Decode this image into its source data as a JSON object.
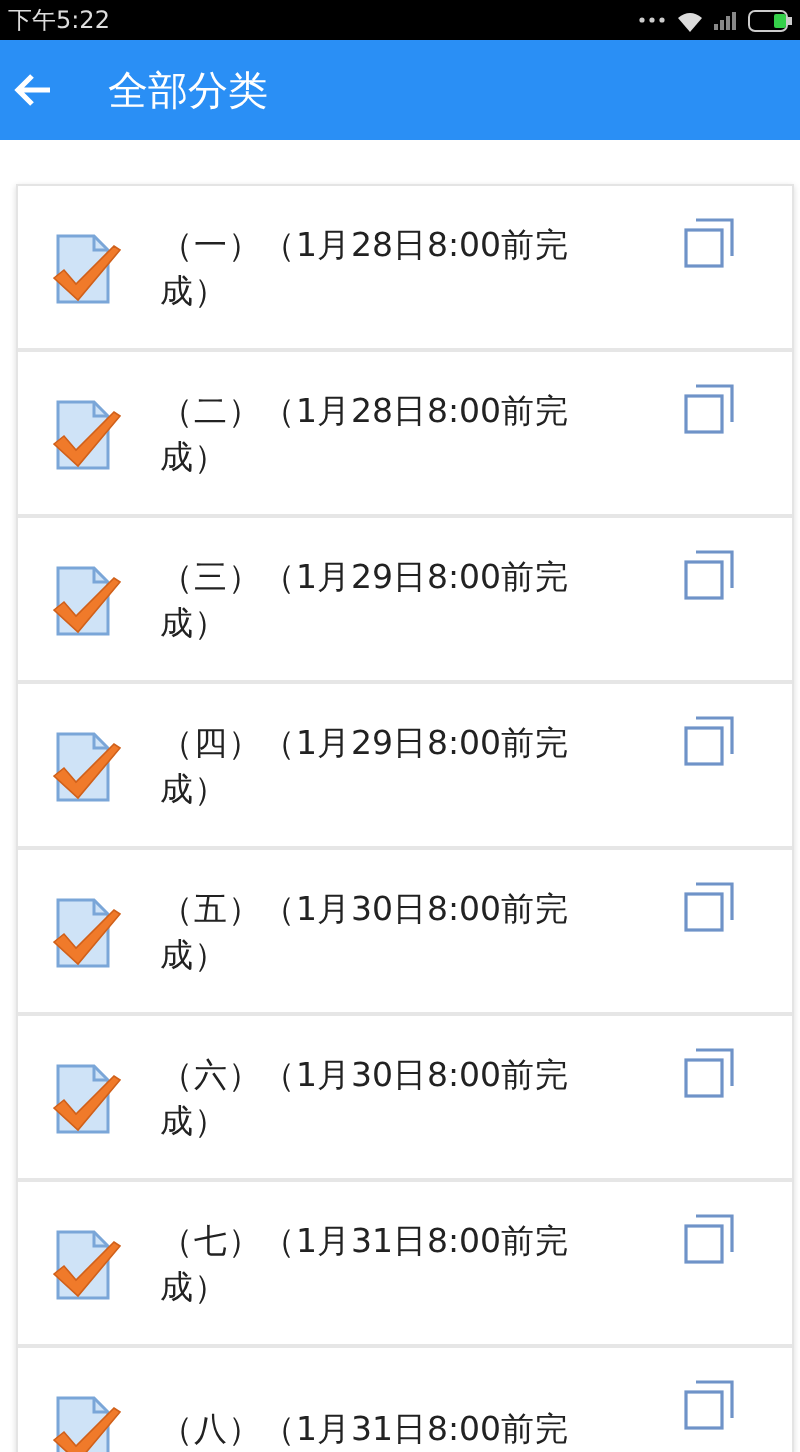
{
  "status_bar": {
    "time": "下午5:22"
  },
  "app_bar": {
    "title": "全部分类"
  },
  "items": [
    {
      "title": "（一）（1月28日8:00前完成）",
      "checked": true
    },
    {
      "title": "（二）（1月28日8:00前完成）",
      "checked": true
    },
    {
      "title": "（三）（1月29日8:00前完成）",
      "checked": true
    },
    {
      "title": "（四）（1月29日8:00前完成）",
      "checked": true
    },
    {
      "title": "（五）（1月30日8:00前完成）",
      "checked": true
    },
    {
      "title": "（六）（1月30日8:00前完成）",
      "checked": true
    },
    {
      "title": "（七）（1月31日8:00前完成）",
      "checked": true
    },
    {
      "title": "（八）（1月31日8:00前完",
      "checked": true
    }
  ]
}
